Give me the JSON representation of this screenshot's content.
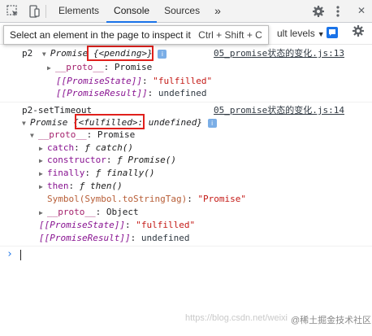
{
  "toolbar": {
    "tabs": [
      {
        "label": "Elements",
        "active": false
      },
      {
        "label": "Console",
        "active": true
      },
      {
        "label": "Sources",
        "active": false
      }
    ],
    "more": "»",
    "close": "✕"
  },
  "tooltip": {
    "text": "Select an element in the page to inspect it",
    "shortcut": "Ctrl + Shift + C"
  },
  "filter": {
    "levels": "ult levels"
  },
  "logs": {
    "p2": {
      "label": "p2",
      "type": "Promise",
      "state": "{<pending>}",
      "source": "05_promise状态的变化.js:13",
      "proto_key": "__proto__",
      "proto_val": "Promise",
      "state_key": "[[PromiseState]]",
      "state_val": "\"fulfilled\"",
      "result_key": "[[PromiseResult]]",
      "result_val": "undefined"
    },
    "p2_timeout": {
      "label": "p2-setTimeout",
      "type": "Promise",
      "open_brace": "{",
      "state": "<fulfilled>",
      "result": ": undefined}",
      "source": "05_promise状态的变化.js:14",
      "proto_key": "__proto__",
      "proto_val": "Promise",
      "catch_key": "catch",
      "catch_val": "catch()",
      "constructor_key": "constructor",
      "constructor_val": "Promise()",
      "finally_key": "finally",
      "finally_val": "finally()",
      "then_key": "then",
      "then_val": "then()",
      "symbol_key": "Symbol(Symbol.toStringTag)",
      "symbol_val": "\"Promise\"",
      "inner_proto_key": "__proto__",
      "inner_proto_val": "Object",
      "state_key": "[[PromiseState]]",
      "state_val": "\"fulfilled\"",
      "result_key": "[[PromiseResult]]",
      "result_val": "undefined"
    }
  },
  "prompt": "›",
  "watermark": "https://blog.csdn.net/weixi",
  "badge": "@稀土掘金技术社区",
  "colors": {
    "highlight": "#e0201c",
    "accent": "#1a73e8"
  }
}
